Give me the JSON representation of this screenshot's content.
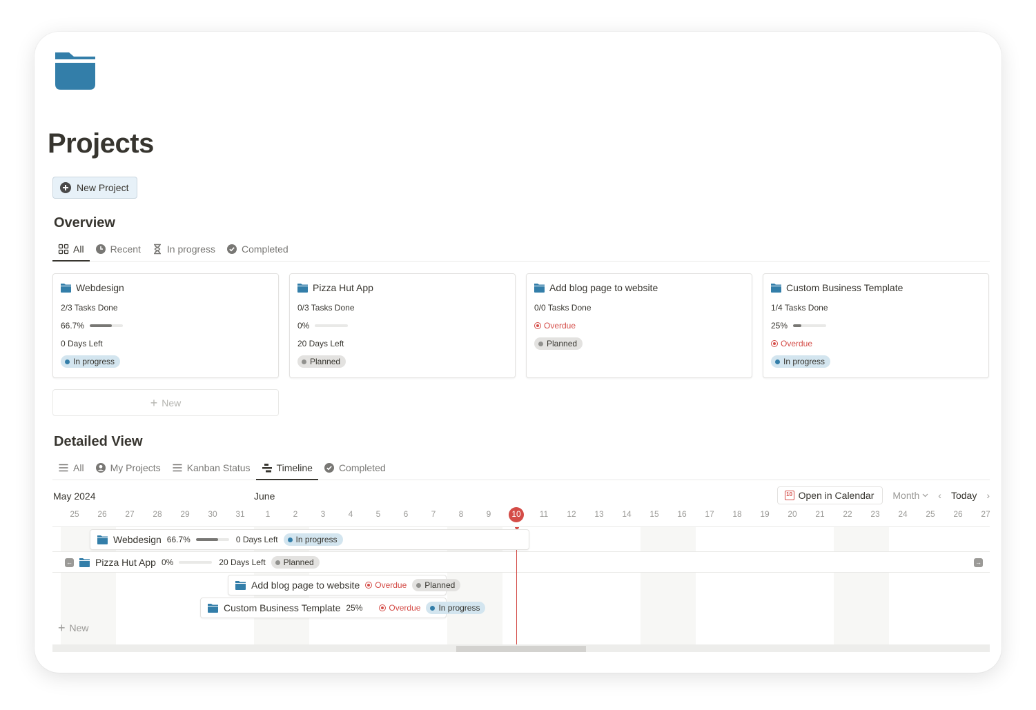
{
  "page": {
    "title": "Projects",
    "icon": "folder-icon",
    "accent_color": "#337ea9"
  },
  "toolbar": {
    "new_project_label": "New Project"
  },
  "overview": {
    "title": "Overview",
    "tabs": [
      {
        "label": "All",
        "icon": "grid-icon",
        "active": true
      },
      {
        "label": "Recent",
        "icon": "clock-icon",
        "active": false
      },
      {
        "label": "In progress",
        "icon": "hourglass-icon",
        "active": false
      },
      {
        "label": "Completed",
        "icon": "check-circle-icon",
        "active": false
      }
    ],
    "cards": [
      {
        "title": "Webdesign",
        "tasks": "2/3 Tasks Done",
        "percent_label": "66.7%",
        "progress": 0.667,
        "days_left": "0 Days Left",
        "overdue": null,
        "status": "In progress",
        "status_type": "progress"
      },
      {
        "title": "Pizza Hut App",
        "tasks": "0/3 Tasks Done",
        "percent_label": "0%",
        "progress": 0,
        "days_left": "20 Days Left",
        "overdue": null,
        "status": "Planned",
        "status_type": "planned"
      },
      {
        "title": "Add blog page to website",
        "tasks": "0/0 Tasks Done",
        "percent_label": null,
        "progress": null,
        "days_left": null,
        "overdue": "Overdue",
        "status": "Planned",
        "status_type": "planned"
      },
      {
        "title": "Custom Business Template",
        "tasks": "1/4 Tasks Done",
        "percent_label": "25%",
        "progress": 0.25,
        "days_left": null,
        "overdue": "Overdue",
        "status": "In progress",
        "status_type": "progress"
      }
    ],
    "new_label": "New"
  },
  "detailed": {
    "title": "Detailed View",
    "tabs": [
      {
        "label": "All",
        "icon": "list-icon",
        "active": false
      },
      {
        "label": "My Projects",
        "icon": "user-circle-icon",
        "active": false
      },
      {
        "label": "Kanban Status",
        "icon": "list-icon",
        "active": false
      },
      {
        "label": "Timeline",
        "icon": "timeline-icon",
        "active": true
      },
      {
        "label": "Completed",
        "icon": "check-circle-icon",
        "active": false
      }
    ]
  },
  "timeline": {
    "month_labels": [
      {
        "label": "May 2024",
        "day_index": 0
      },
      {
        "label": "June",
        "day_index": 7
      }
    ],
    "days": [
      "25",
      "26",
      "27",
      "28",
      "29",
      "30",
      "31",
      "1",
      "2",
      "3",
      "4",
      "5",
      "6",
      "7",
      "8",
      "9",
      "10",
      "11",
      "12",
      "13",
      "14",
      "15",
      "16",
      "17",
      "18",
      "19",
      "20",
      "21",
      "22",
      "23",
      "24",
      "25",
      "26",
      "27"
    ],
    "today_index": 16,
    "open_calendar_label": "Open in Calendar",
    "calendar_icon_text": "10",
    "view_mode": "Month",
    "today_label": "Today",
    "rows": [
      {
        "title": "Webdesign",
        "percent_label": "66.7%",
        "progress": 0.667,
        "days_left": "0 Days Left",
        "overdue": null,
        "status": "In progress",
        "status_type": "progress"
      },
      {
        "title": "Pizza Hut App",
        "percent_label": "0%",
        "progress": 0,
        "days_left": "20 Days Left",
        "overdue": null,
        "status": "Planned",
        "status_type": "planned"
      },
      {
        "title": "Add blog page to website",
        "percent_label": null,
        "progress": null,
        "days_left": null,
        "overdue": "Overdue",
        "status": "Planned",
        "status_type": "planned"
      },
      {
        "title": "Custom Business Template",
        "percent_label": "25%",
        "progress": 0.25,
        "days_left": null,
        "overdue": "Overdue",
        "status": "In progress",
        "status_type": "progress"
      }
    ],
    "new_label": "New"
  }
}
